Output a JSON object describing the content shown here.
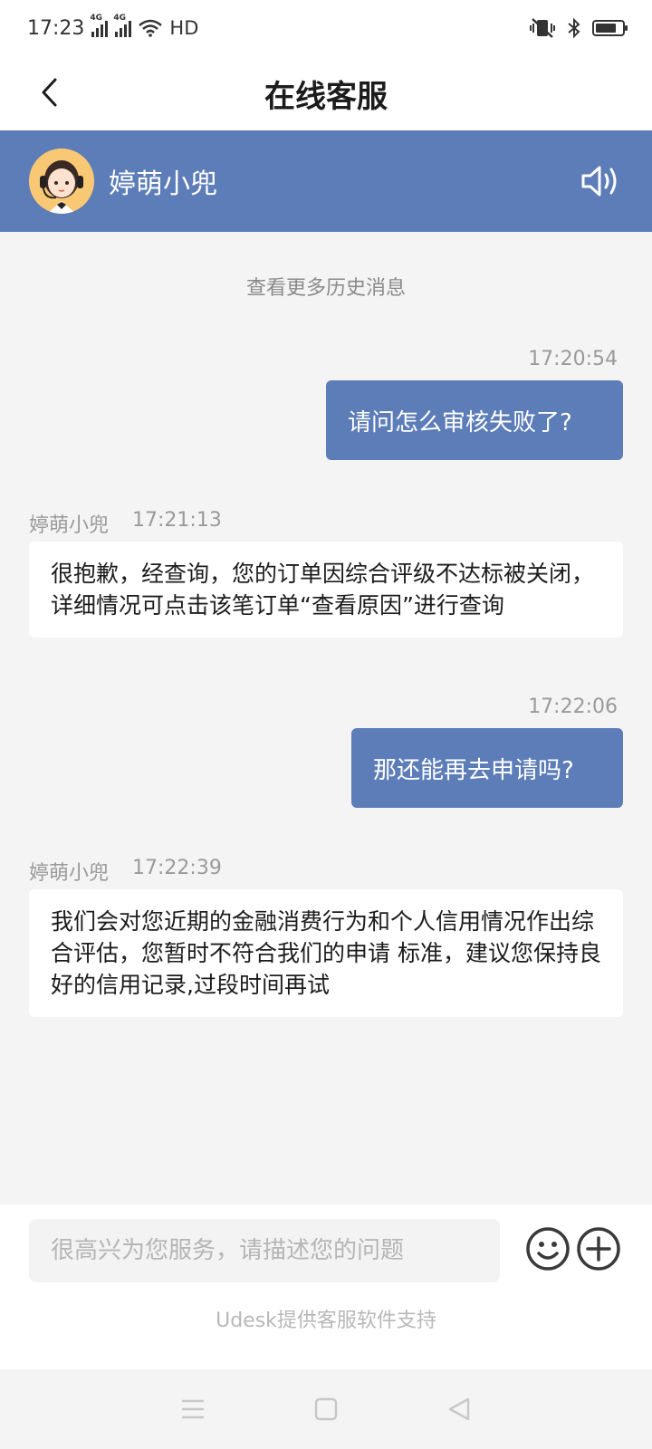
{
  "status_bar": {
    "time": "17:23",
    "network1": "4G",
    "network2": "4G",
    "hd_label": "HD",
    "battery_level": 0.8
  },
  "header": {
    "title": "在线客服",
    "back_icon": "chevron-left-icon"
  },
  "agent": {
    "name": "婷萌小兜",
    "avatar_icon": "agent-avatar-icon",
    "speaker_icon": "speaker-icon"
  },
  "history_link": "查看更多历史消息",
  "messages": [
    {
      "from": "user",
      "time": "17:20:54",
      "text": "请问怎么审核失败了?"
    },
    {
      "from": "agent",
      "sender": "婷萌小兜",
      "time": "17:21:13",
      "text": "很抱歉，经查询，您的订单因综合评级不达标被关闭，详细情况可点击该笔订单“查看原因”进行查询"
    },
    {
      "from": "user",
      "time": "17:22:06",
      "text": "那还能再去申请吗?"
    },
    {
      "from": "agent",
      "sender": "婷萌小兜",
      "time": "17:22:39",
      "text": "我们会对您近期的金融消费行为和个人信用情况作出综合评估，您暂时不符合我们的申请 标准，建议您保持良好的信用记录,过段时间再试"
    }
  ],
  "composer": {
    "placeholder": "很高兴为您服务，请描述您的问题",
    "value": "",
    "emoji_icon": "smiley-icon",
    "plus_icon": "plus-circle-icon"
  },
  "powered_by": "Udesk提供客服软件支持",
  "nav": {
    "menu_icon": "menu-icon",
    "home_icon": "home-square-icon",
    "back_icon": "back-triangle-icon"
  },
  "colors": {
    "accent": "#5c7db8",
    "background": "#f4f4f5"
  }
}
